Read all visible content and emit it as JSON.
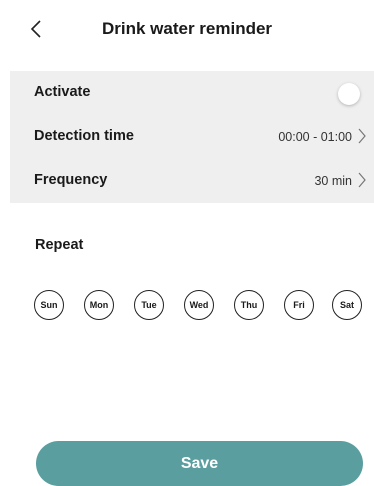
{
  "header": {
    "title": "Drink water reminder",
    "back_icon": "chevron-left-icon"
  },
  "settings": {
    "activate": {
      "label": "Activate",
      "enabled": false
    },
    "detection_time": {
      "label": "Detection time",
      "value": "00:00 - 01:00"
    },
    "frequency": {
      "label": "Frequency",
      "value": "30 min"
    }
  },
  "repeat": {
    "label": "Repeat",
    "days": [
      "Sun",
      "Mon",
      "Tue",
      "Wed",
      "Thu",
      "Fri",
      "Sat"
    ]
  },
  "actions": {
    "save_label": "Save"
  },
  "colors": {
    "accent": "#5b9ea0",
    "panel_bg": "#efefef"
  }
}
